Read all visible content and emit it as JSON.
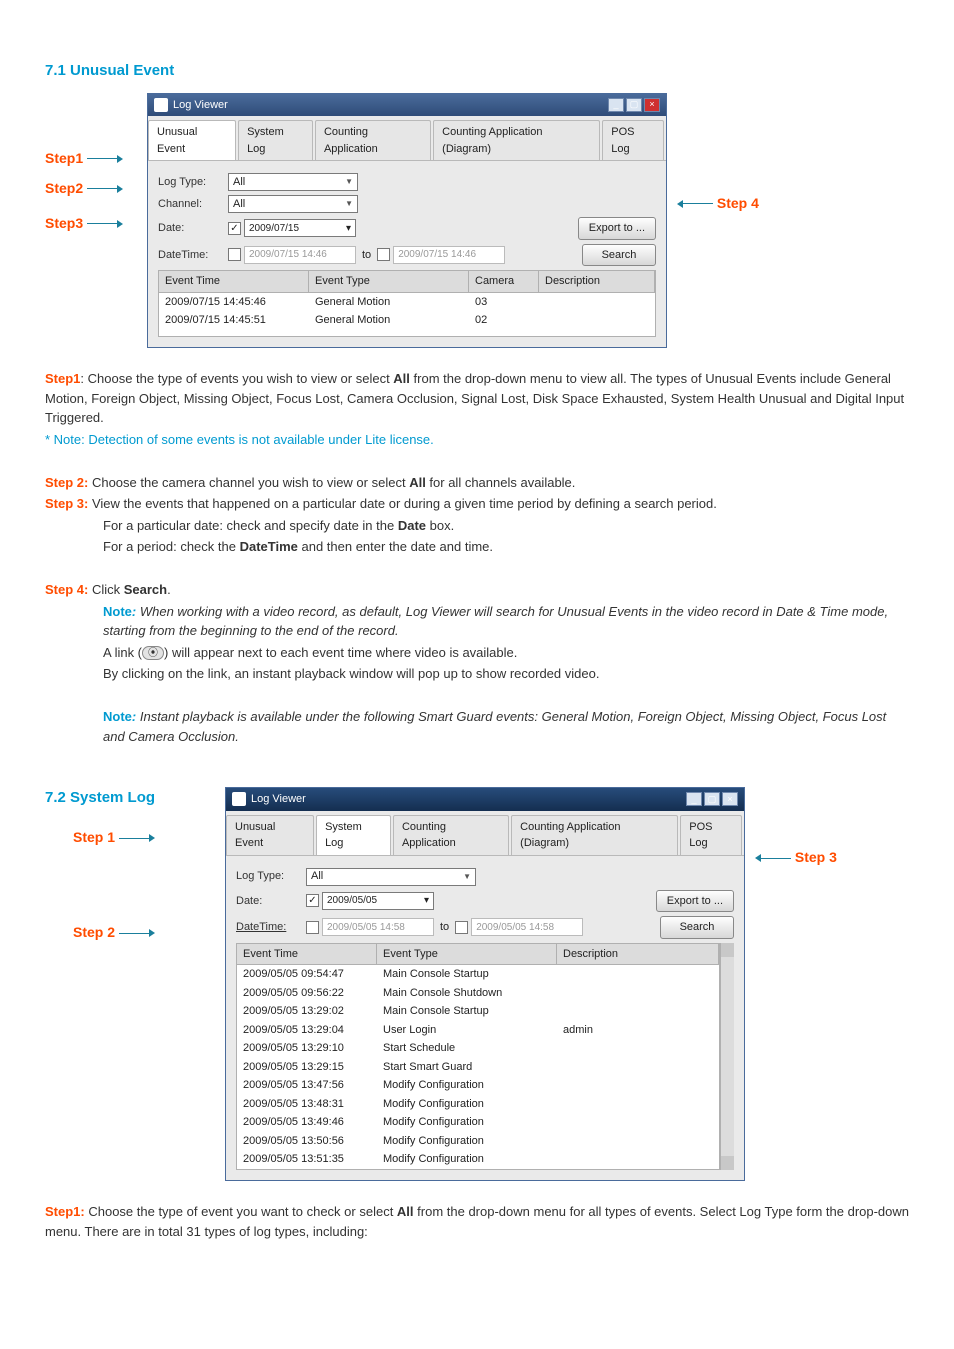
{
  "section71": {
    "title": "7.1 Unusual Event",
    "window_title": "Log Viewer",
    "tabs": [
      "Unusual Event",
      "System Log",
      "Counting Application",
      "Counting Application (Diagram)",
      "POS Log"
    ],
    "labels": {
      "logtype": "Log Type:",
      "channel": "Channel:",
      "date": "Date:",
      "datetime": "DateTime:",
      "to": "to"
    },
    "values": {
      "logtype": "All",
      "channel": "All",
      "date": "2009/07/15",
      "dt_from": "2009/07/15 14:46",
      "dt_to": "2009/07/15 14:46"
    },
    "buttons": {
      "export": "Export to ...",
      "search": "Search"
    },
    "cols": [
      "Event Time",
      "Event Type",
      "Camera",
      "Description"
    ],
    "rows": [
      {
        "time": "2009/07/15 14:45:46",
        "type": "General Motion",
        "cam": "03",
        "desc": ""
      },
      {
        "time": "2009/07/15 14:45:51",
        "type": "General Motion",
        "cam": "02",
        "desc": ""
      }
    ],
    "step_labels": {
      "s1": "Step1",
      "s2": "Step2",
      "s3": "Step3",
      "s4": "Step 4"
    }
  },
  "text71": {
    "s1_label": "Step1",
    "s1a": ": Choose the type of events you wish to view or select ",
    "all": "All",
    "s1b": " from the drop-down menu to view all. The types of Unusual Events include General Motion, Foreign Object, Missing Object, Focus Lost, Camera Occlusion, Signal Lost, Disk Space Exhausted, System Health Unusual and Digital Input Triggered.",
    "note1": "* Note: Detection of some events is not available under Lite license.",
    "s2_label": "Step 2:",
    "s2": " Choose the camera channel you wish to view or select ",
    "s2b": " for all channels available.",
    "s3_label": "Step 3:",
    "s3": " View the events that happened on a particular date or during a given time period by defining a search period.",
    "s3_line1a": "For a particular date: check and specify date in the ",
    "s3_date": "Date",
    "s3_line1b": " box.",
    "s3_line2a": "For a period: check the ",
    "s3_dt": "DateTime",
    "s3_line2b": " and then enter the date and time.",
    "s4_label": "Step 4:",
    "s4a": " Click ",
    "s4_search": "Search",
    "s4b": ".",
    "note2_label": "Note",
    "note2": " When working with a video record, as default, Log Viewer will search for Unusual Events in the video record in Date & Time mode, starting from the beginning to the end of the record.",
    "link_a": "A link (",
    "link_b": ") will appear next to each event time where video is available.",
    "link_c": "By clicking on the link, an instant playback window will pop up to show recorded video.",
    "note3": " Instant playback is available under the following Smart Guard events: General Motion, Foreign Object, Missing Object, Focus Lost and Camera Occlusion."
  },
  "section72": {
    "title": "7.2 System Log",
    "window_title": "Log Viewer",
    "tabs": [
      "Unusual Event",
      "System Log",
      "Counting Application",
      "Counting Application (Diagram)",
      "POS Log"
    ],
    "labels": {
      "logtype": "Log Type:",
      "date": "Date:",
      "datetime": "DateTime:",
      "to": "to"
    },
    "values": {
      "logtype": "All",
      "date": "2009/05/05",
      "dt_from": "2009/05/05 14:58",
      "dt_to": "2009/05/05 14:58"
    },
    "buttons": {
      "export": "Export to ...",
      "search": "Search"
    },
    "cols": [
      "Event Time",
      "Event Type",
      "Description"
    ],
    "rows": [
      {
        "time": "2009/05/05 09:54:47",
        "type": "Main Console Startup",
        "desc": ""
      },
      {
        "time": "2009/05/05 09:56:22",
        "type": "Main Console Shutdown",
        "desc": ""
      },
      {
        "time": "2009/05/05 13:29:02",
        "type": "Main Console Startup",
        "desc": ""
      },
      {
        "time": "2009/05/05 13:29:04",
        "type": "User Login",
        "desc": "admin"
      },
      {
        "time": "2009/05/05 13:29:10",
        "type": "Start Schedule",
        "desc": ""
      },
      {
        "time": "2009/05/05 13:29:15",
        "type": "Start Smart Guard",
        "desc": ""
      },
      {
        "time": "2009/05/05 13:47:56",
        "type": "Modify Configuration",
        "desc": ""
      },
      {
        "time": "2009/05/05 13:48:31",
        "type": "Modify Configuration",
        "desc": ""
      },
      {
        "time": "2009/05/05 13:49:46",
        "type": "Modify Configuration",
        "desc": ""
      },
      {
        "time": "2009/05/05 13:50:56",
        "type": "Modify Configuration",
        "desc": ""
      },
      {
        "time": "2009/05/05 13:51:35",
        "type": "Modify Configuration",
        "desc": ""
      }
    ],
    "step_labels": {
      "s1": "Step 1",
      "s2": "Step 2",
      "s3": "Step 3"
    }
  },
  "text72": {
    "s1_label": "Step1:",
    "s1a": " Choose the type of event you want to check or select ",
    "all": "All",
    "s1b": " from the drop-down menu for all types of events. Select Log Type form the drop-down menu. There are in total 31 types of log types, including:"
  }
}
